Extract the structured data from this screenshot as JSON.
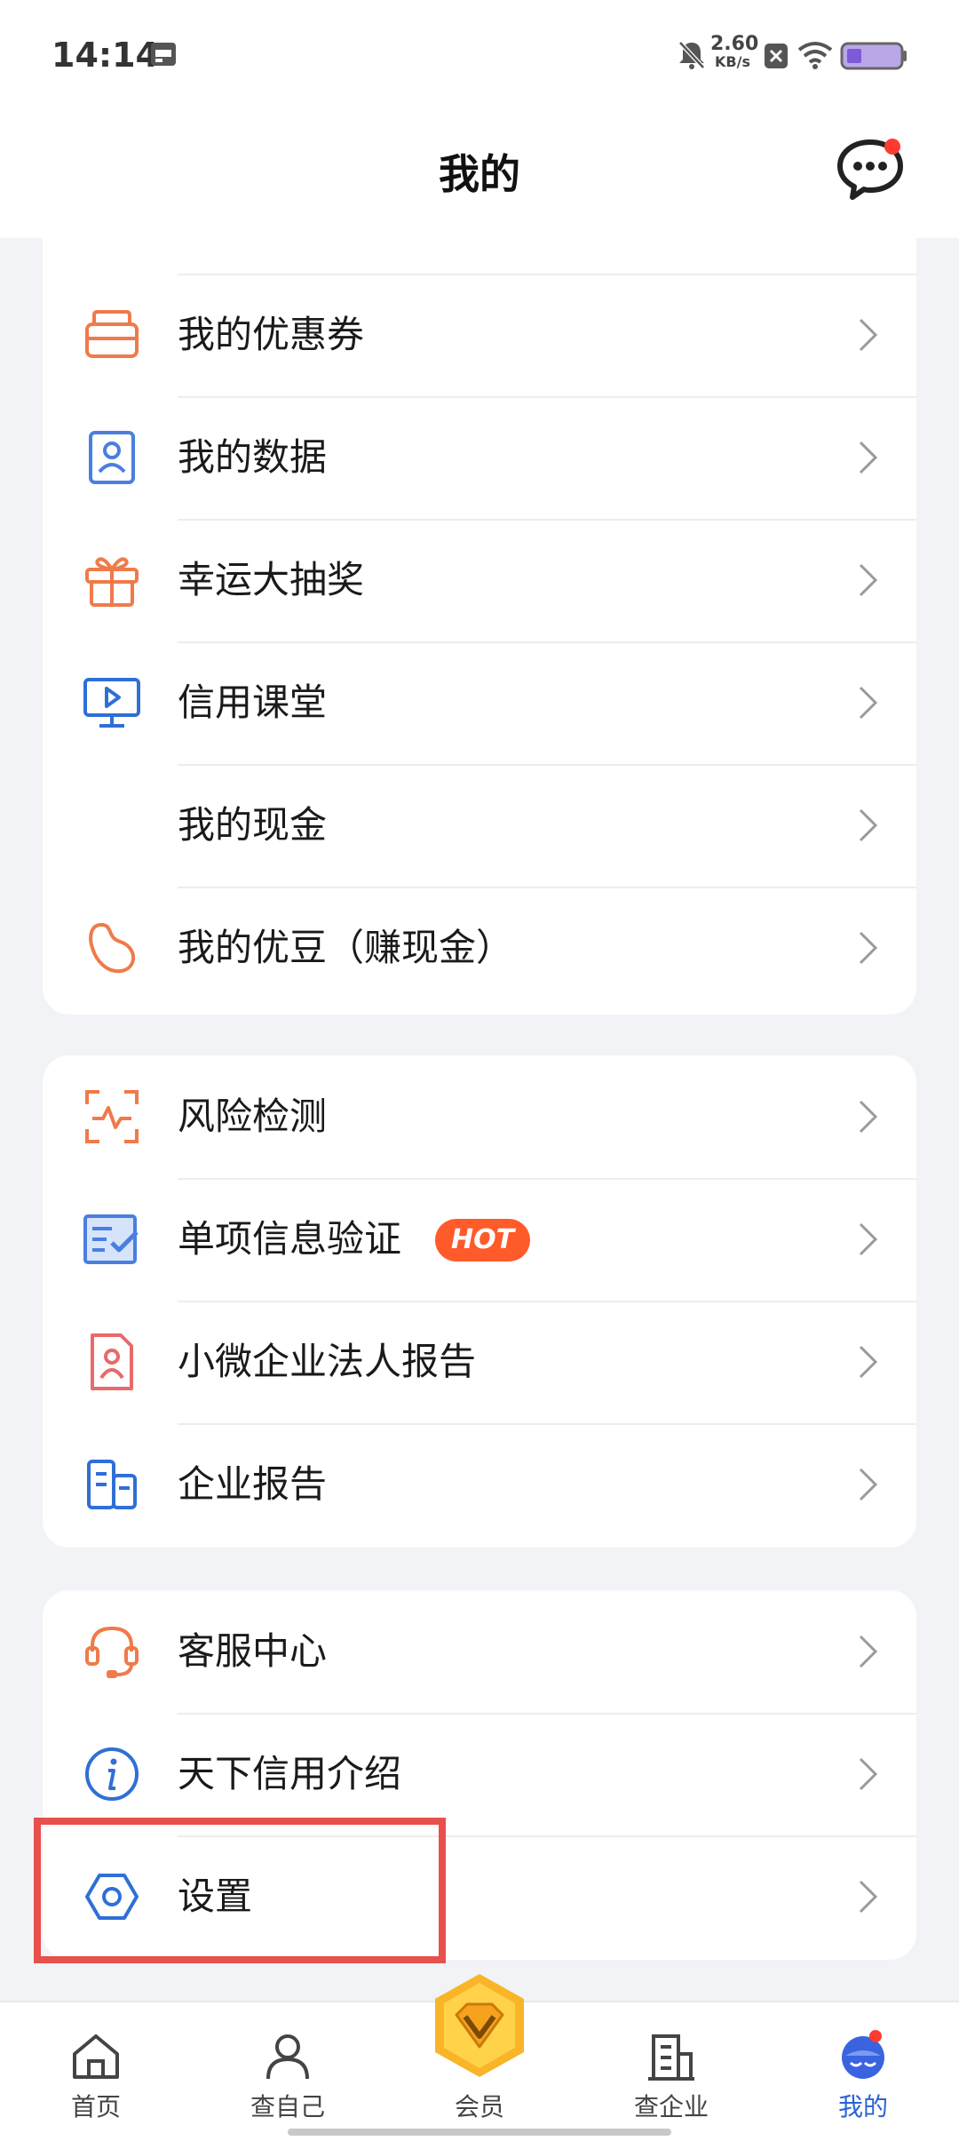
{
  "status_bar": {
    "time": "14:14",
    "net_speed": "2.60",
    "net_unit": "KB/s"
  },
  "header": {
    "title": "我的"
  },
  "section1": [
    {
      "label": "我的优惠券",
      "icon": "coupon-icon"
    },
    {
      "label": "我的数据",
      "icon": "user-data-icon"
    },
    {
      "label": "幸运大抽奖",
      "icon": "gift-icon"
    },
    {
      "label": "信用课堂",
      "icon": "video-class-icon"
    },
    {
      "label": "我的现金",
      "icon": ""
    },
    {
      "label": "我的优豆（赚现金）",
      "icon": "bean-icon"
    }
  ],
  "section2": [
    {
      "label": "风险检测",
      "icon": "risk-scan-icon"
    },
    {
      "label": "单项信息验证",
      "icon": "verify-icon",
      "badge": "HOT"
    },
    {
      "label": "小微企业法人报告",
      "icon": "legal-report-icon"
    },
    {
      "label": "企业报告",
      "icon": "company-report-icon"
    }
  ],
  "section3": [
    {
      "label": "客服中心",
      "icon": "headset-icon"
    },
    {
      "label": "天下信用介绍",
      "icon": "info-icon"
    },
    {
      "label": "设置",
      "icon": "settings-icon"
    }
  ],
  "tabbar": [
    {
      "label": "首页",
      "icon": "home-icon"
    },
    {
      "label": "查自己",
      "icon": "person-icon"
    },
    {
      "label": "会员",
      "icon": "vip-diamond-icon"
    },
    {
      "label": "查企业",
      "icon": "building-icon"
    },
    {
      "label": "我的",
      "icon": "mine-avatar-icon",
      "active": true
    }
  ],
  "colors": {
    "accent": "#2a62d8",
    "orange": "#f07a4a",
    "blue_icon": "#4a7fe0",
    "highlight": "#e8504c",
    "hot": "#ff5a2a"
  }
}
